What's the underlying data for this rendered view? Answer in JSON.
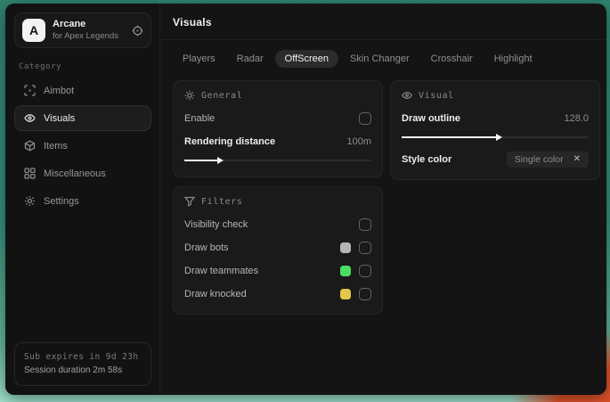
{
  "backdrop_colors": {
    "teal": "#2f8570",
    "mint": "#9fe0cc",
    "orange": "#e0512b"
  },
  "brand": {
    "initial": "A",
    "title": "Arcane",
    "subtitle": "for Apex Legends"
  },
  "sidebar": {
    "category_label": "Category",
    "items": [
      {
        "label": "Aimbot"
      },
      {
        "label": "Visuals"
      },
      {
        "label": "Items"
      },
      {
        "label": "Miscellaneous"
      },
      {
        "label": "Settings"
      }
    ],
    "footer": {
      "sub_expires": "Sub expires in 9d 23h",
      "session_duration": "Session duration 2m 58s"
    }
  },
  "main": {
    "title": "Visuals",
    "active_tab": "OffScreen",
    "tabs": [
      {
        "label": "Players"
      },
      {
        "label": "Radar"
      },
      {
        "label": "OffScreen"
      },
      {
        "label": "Skin Changer"
      },
      {
        "label": "Crosshair"
      },
      {
        "label": "Highlight"
      }
    ]
  },
  "panels": {
    "general": {
      "title": "General",
      "enable_label": "Enable",
      "enable_checked": false,
      "rendering_distance_label": "Rendering distance",
      "rendering_distance_value": "100m",
      "slider_width": "18%"
    },
    "visual": {
      "title": "Visual",
      "draw_outline_label": "Draw outline",
      "draw_outline_value": "128.0",
      "slider_width": "51%",
      "style_color_label": "Style color",
      "style_color_value": "Single color",
      "style_color_clear": "✕"
    },
    "filters": {
      "title": "Filters",
      "rows": [
        {
          "label": "Visibility check",
          "checked": false
        },
        {
          "label": "Draw bots",
          "swatch": "#b5b5b5",
          "checked": false
        },
        {
          "label": "Draw teammates",
          "swatch": "#4ade60",
          "checked": false
        },
        {
          "label": "Draw knocked",
          "swatch": "#e5c54b",
          "checked": false
        }
      ]
    }
  }
}
